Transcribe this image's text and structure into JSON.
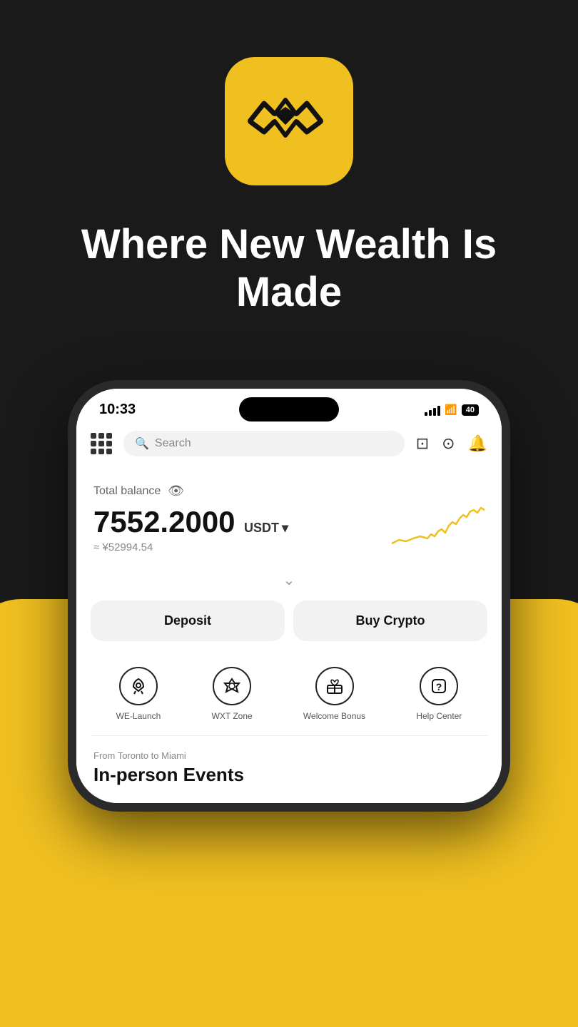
{
  "hero": {
    "tagline": "Where New Wealth Is Made"
  },
  "status_bar": {
    "time": "10:33",
    "battery": "40"
  },
  "header": {
    "search_placeholder": "Search"
  },
  "balance": {
    "label": "Total balance",
    "amount": "7552.2000",
    "currency": "USDT",
    "fiat_approx": "≈ ¥52994.54"
  },
  "actions": {
    "deposit_label": "Deposit",
    "buy_crypto_label": "Buy Crypto"
  },
  "features": [
    {
      "id": "we-launch",
      "label": "WE-Launch",
      "icon": "🚀"
    },
    {
      "id": "wxt-zone",
      "label": "WXT Zone",
      "icon": "◈"
    },
    {
      "id": "welcome-bonus",
      "label": "Welcome Bonus",
      "icon": "🎁"
    },
    {
      "id": "help-center",
      "label": "Help Center",
      "icon": "❓"
    }
  ],
  "events": {
    "subtitle": "From Toronto to Miami",
    "title": "In-person Events"
  }
}
